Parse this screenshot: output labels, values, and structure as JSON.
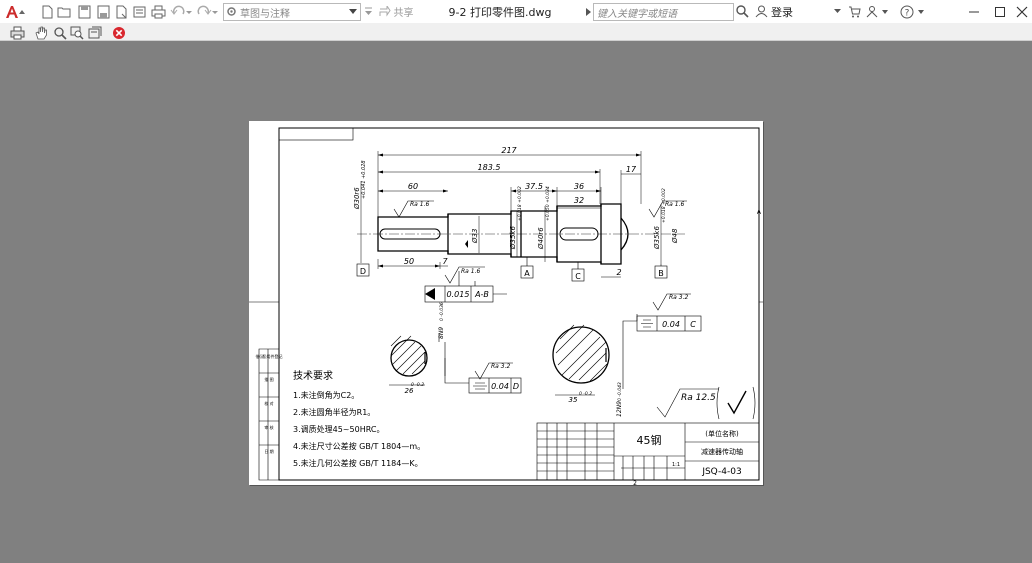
{
  "app": {
    "document_title": "9-2 打印零件图.dwg",
    "workspace": "草图与注释",
    "share_label": "共享",
    "search_placeholder": "键入关键字或短语",
    "login_label": "登录",
    "window_controls": [
      "minimize-icon",
      "maximize-icon",
      "close-icon"
    ]
  },
  "toolbar": {
    "quick_access_icons": [
      "new-icon",
      "open-icon",
      "save-icon",
      "save-as-icon",
      "open-sheet-icon",
      "print-icon",
      "publish-icon",
      "undo-icon",
      "redo-icon"
    ],
    "preview_icons": [
      "print-icon",
      "pan-icon",
      "zoom-icon",
      "zoom-window-icon",
      "zoom-original-icon",
      "close-preview-icon"
    ],
    "accent_color": "#cc2b2b"
  },
  "drawing": {
    "dims": {
      "d217": "217",
      "d1835": "183.5",
      "d60": "60",
      "d375": "37.5",
      "d36": "36",
      "d32": "32",
      "d17": "17",
      "d50": "50",
      "d7": "7",
      "d2": "2",
      "phi30": "Ø30r6",
      "phi30_tol": "+0.041 +0.028",
      "phi33": "Ø33",
      "phi35a": "Ø35k6",
      "phi35_tol": "+0.018 +0.002",
      "phi40": "Ø40r6",
      "phi40_tol": "+0.050 +0.034",
      "phi35b": "Ø35k6",
      "phi48": "Ø48",
      "key1_depth": "26",
      "key1_tol": "0 -0.2",
      "key2_depth": "35",
      "key2_tol": "0 -0.2",
      "key1_width": "8N9",
      "key1_width_tol": "0 -0.036",
      "key2_width": "12N9",
      "key2_width_tol": "0 -0.043"
    },
    "datums": {
      "d": "D",
      "a": "A",
      "c": "C",
      "b": "B"
    },
    "roughness": {
      "ra16": "Ra 1.6",
      "ra32": "Ra 3.2",
      "ra125": "Ra 12.5"
    },
    "fcf": {
      "runout_value": "0.015",
      "runout_datum": "A-B",
      "sym1_value": "0.04",
      "sym1_datum": "C",
      "sym2_value": "0.04",
      "sym2_datum": "D"
    },
    "tech_title": "技术要求",
    "tech_notes": [
      "1.未注倒角为C2。",
      "2.未注圆角半径为R1。",
      "3.调质处理45~50HRC。",
      "4.未注尺寸公差按 GB/T 1804—m。",
      "5.未注几何公差按 GB/T 1184—K。"
    ],
    "side_labels": [
      "借(通)用件登记",
      "描 图",
      "校 对",
      "审 核",
      "日 期"
    ],
    "title_block": {
      "material": "45钢",
      "company": "(单位名称)",
      "part_name": "减速器传动轴",
      "drawing_no": "JSQ-4-03",
      "scale": "1:1"
    },
    "sheet_marks": {
      "bottom": "2",
      "right": "A"
    }
  }
}
